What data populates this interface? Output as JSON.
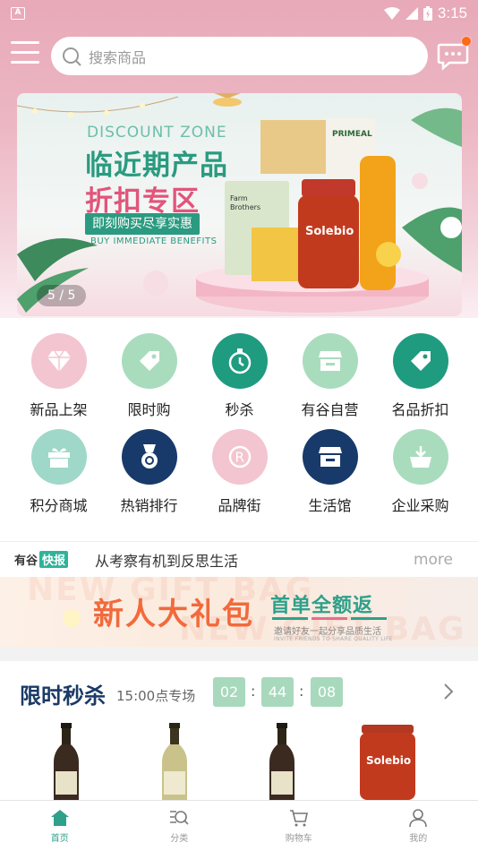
{
  "status_bar": {
    "time": "3:15",
    "sim_label": "A"
  },
  "search": {
    "placeholder": "搜索商品"
  },
  "banner": {
    "en_title": "DISCOUNT ZONE",
    "line1": "临近期产品",
    "line2": "折扣专区",
    "line3": "即刻购买尽享实惠",
    "line4": "BUY IMMEDIATE BENEFITS",
    "pager": "5 / 5",
    "product_labels": [
      "PRIMEAL",
      "Farm Brothers",
      "Solebio"
    ]
  },
  "categories": [
    {
      "label": "新品上架",
      "icon": "diamond-icon",
      "color": "#f3c5d0"
    },
    {
      "label": "限时购",
      "icon": "tag-icon",
      "color": "#a9dcbd"
    },
    {
      "label": "秒杀",
      "icon": "stopwatch-icon",
      "color": "#1f9b80"
    },
    {
      "label": "有谷自营",
      "icon": "store-icon",
      "color": "#a9dcbd"
    },
    {
      "label": "名品折扣",
      "icon": "tag-icon",
      "color": "#1f9b80"
    },
    {
      "label": "积分商城",
      "icon": "gift-icon",
      "color": "#9fd8c8"
    },
    {
      "label": "热销排行",
      "icon": "medal-icon",
      "color": "#183a6b"
    },
    {
      "label": "品牌街",
      "icon": "registered-icon",
      "color": "#f3c5d0"
    },
    {
      "label": "生活馆",
      "icon": "store-icon",
      "color": "#183a6b"
    },
    {
      "label": "企业采购",
      "icon": "basket-icon",
      "color": "#a9dcbd"
    }
  ],
  "news": {
    "brand_a": "有谷",
    "brand_b": "快报",
    "headline": "从考察有机到反思生活",
    "more": "more"
  },
  "gift_banner": {
    "bg_text_1": "NEW GIFT BAG",
    "bg_text_2": "NEW GIFT BAG",
    "title": "新人大礼包",
    "subtitle": "首单全额返",
    "caption": "邀请好友一起分享品质生活",
    "caption_en": "INVITE FRIENDS TO SHARE QUALITY LIFE"
  },
  "flash_sale": {
    "title": "限时秒杀",
    "session": "15:00点专场",
    "countdown": [
      "02",
      "44",
      "08"
    ]
  },
  "bottom_nav": [
    {
      "label": "首页",
      "icon": "home-icon",
      "active": true
    },
    {
      "label": "分类",
      "icon": "category-search-icon",
      "active": false
    },
    {
      "label": "购物车",
      "icon": "cart-icon",
      "active": false
    },
    {
      "label": "我的",
      "icon": "user-icon",
      "active": false
    }
  ],
  "colors": {
    "accent": "#2fa08a",
    "navy": "#183a6b",
    "pink": "#e8a9b8",
    "badge": "#ff6a13"
  }
}
